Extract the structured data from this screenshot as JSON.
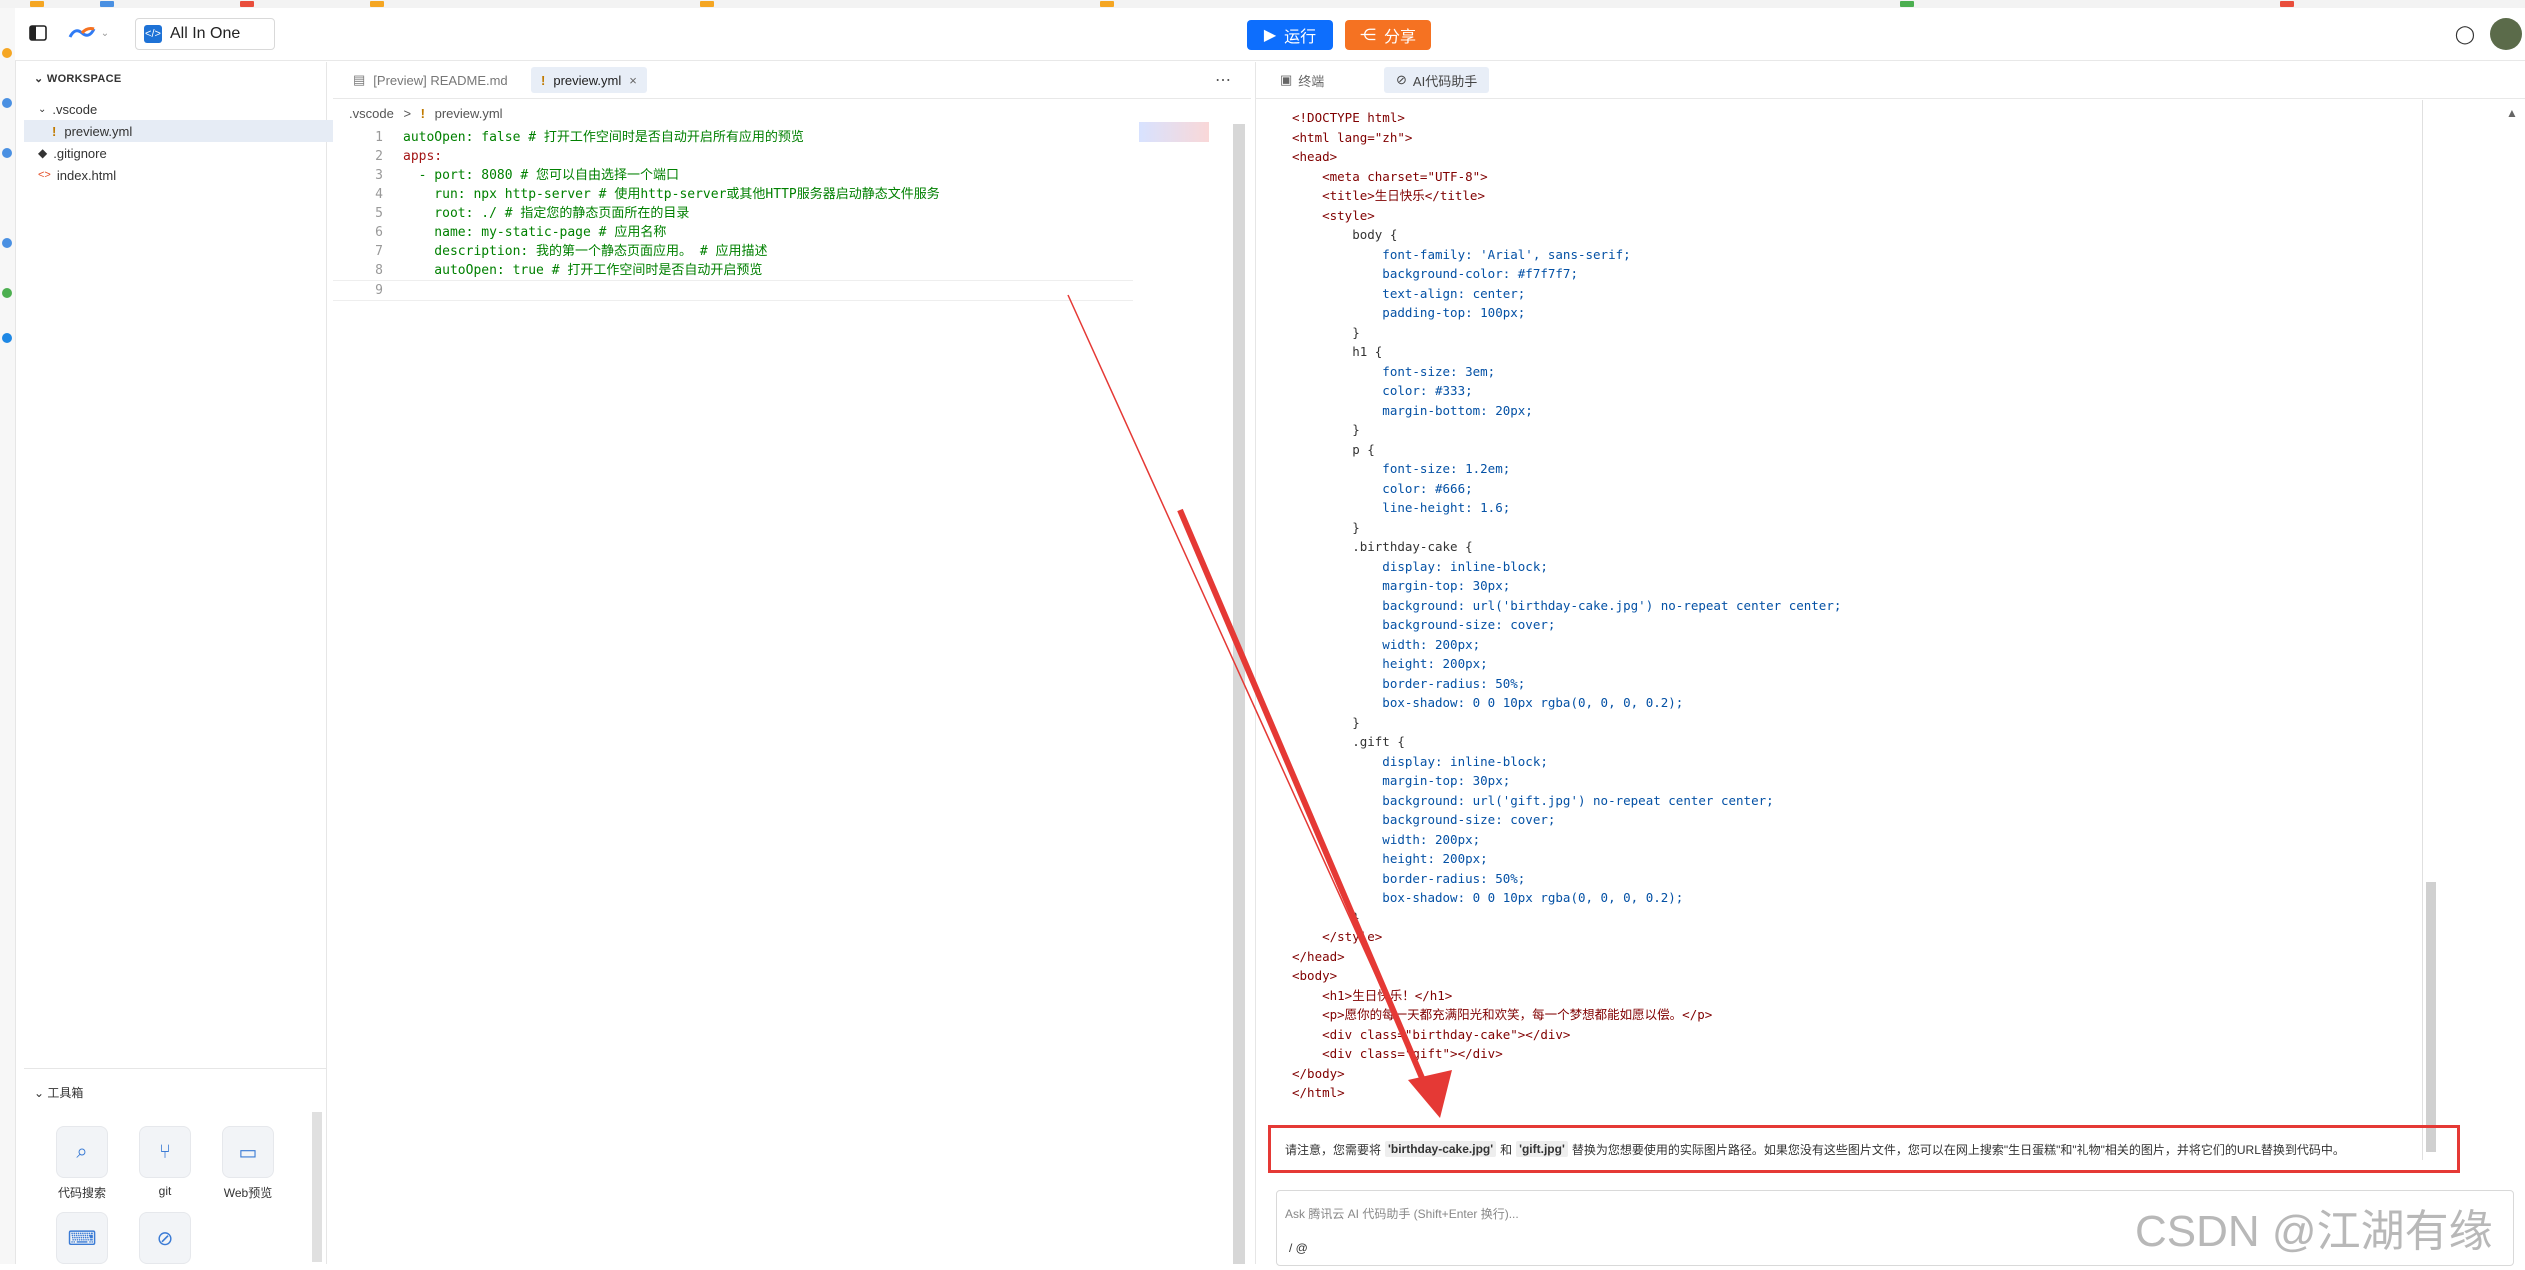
{
  "header": {
    "workspace_name": "All In One",
    "run_label": "运行",
    "share_label": "分享"
  },
  "sidebar": {
    "title": "WORKSPACE",
    "tree": [
      {
        "label": ".vscode",
        "kind": "folder"
      },
      {
        "label": "preview.yml",
        "kind": "yml"
      },
      {
        "label": ".gitignore",
        "kind": "git"
      },
      {
        "label": "index.html",
        "kind": "html"
      }
    ],
    "toolbox_title": "工具箱",
    "tools": [
      {
        "label": "代码搜索",
        "icon": "search-icon"
      },
      {
        "label": "git",
        "icon": "git-icon"
      },
      {
        "label": "Web预览",
        "icon": "monitor-icon"
      },
      {
        "label": "",
        "icon": "terminal-icon"
      },
      {
        "label": "",
        "icon": "globe-icon"
      }
    ]
  },
  "editor": {
    "tabs": [
      {
        "label": "[Preview] README.md",
        "active": false
      },
      {
        "label": "preview.yml",
        "active": true
      }
    ],
    "breadcrumb": [
      ".vscode",
      ">",
      "!",
      "preview.yml"
    ],
    "lines": [
      {
        "n": "1",
        "text": "autoOpen: false # 打开工作空间时是否自动开启所有应用的预览"
      },
      {
        "n": "2",
        "text": "apps:"
      },
      {
        "n": "3",
        "text": "  - port: 8080 # 您可以自由选择一个端口"
      },
      {
        "n": "4",
        "text": "    run: npx http-server # 使用http-server或其他HTTP服务器启动静态文件服务"
      },
      {
        "n": "5",
        "text": "    root: ./ # 指定您的静态页面所在的目录"
      },
      {
        "n": "6",
        "text": "    name: my-static-page # 应用名称"
      },
      {
        "n": "7",
        "text": "    description: 我的第一个静态页面应用。 # 应用描述"
      },
      {
        "n": "8",
        "text": "    autoOpen: true # 打开工作空间时是否自动开启预览"
      },
      {
        "n": "9",
        "text": ""
      }
    ]
  },
  "right_panel": {
    "tabs": [
      {
        "label": "终端",
        "active": false
      },
      {
        "label": "AI代码助手",
        "active": true
      }
    ],
    "code": [
      "<!DOCTYPE html>",
      "<html lang=\"zh\">",
      "<head>",
      "    <meta charset=\"UTF-8\">",
      "    <title>生日快乐</title>",
      "    <style>",
      "        body {",
      "            font-family: 'Arial', sans-serif;",
      "            background-color: #f7f7f7;",
      "            text-align: center;",
      "            padding-top: 100px;",
      "        }",
      "        h1 {",
      "            font-size: 3em;",
      "            color: #333;",
      "            margin-bottom: 20px;",
      "        }",
      "        p {",
      "            font-size: 1.2em;",
      "            color: #666;",
      "            line-height: 1.6;",
      "        }",
      "        .birthday-cake {",
      "            display: inline-block;",
      "            margin-top: 30px;",
      "            background: url('birthday-cake.jpg') no-repeat center center;",
      "            background-size: cover;",
      "            width: 200px;",
      "            height: 200px;",
      "            border-radius: 50%;",
      "            box-shadow: 0 0 10px rgba(0, 0, 0, 0.2);",
      "        }",
      "        .gift {",
      "            display: inline-block;",
      "            margin-top: 30px;",
      "            background: url('gift.jpg') no-repeat center center;",
      "            background-size: cover;",
      "            width: 200px;",
      "            height: 200px;",
      "            border-radius: 50%;",
      "            box-shadow: 0 0 10px rgba(0, 0, 0, 0.2);",
      "        }",
      "    </style>",
      "</head>",
      "<body>",
      "    <h1>生日快乐！</h1>",
      "    <p>愿你的每一天都充满阳光和欢笑，每一个梦想都能如愿以偿。</p>",
      "    <div class=\"birthday-cake\"></div>",
      "    <div class=\"gift\"></div>",
      "</body>",
      "</html>"
    ],
    "notice": {
      "pre": "请注意，您需要将",
      "chip1": "'birthday-cake.jpg'",
      "mid": "和",
      "chip2": "'gift.jpg'",
      "post": "替换为您想要使用的实际图片路径。如果您没有这些图片文件，您可以在网上搜索\"生日蛋糕\"和\"礼物\"相关的图片，并将它们的URL替换到代码中。"
    },
    "ask_placeholder": "Ask 腾讯云 AI 代码助手 (Shift+Enter 换行)...",
    "ask_symbols": "/  @"
  },
  "watermark": "CSDN @江湖有缘"
}
